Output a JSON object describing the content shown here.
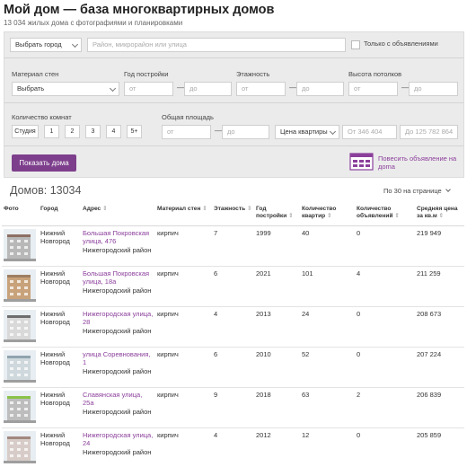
{
  "header": {
    "title": "Мой дом — база многоквартирных домов",
    "subtitle": "13 034 жилых дома с фотографиями и планировками"
  },
  "filters": {
    "city_select": "Выбрать город",
    "search_placeholder": "Район, микрорайон или улица",
    "only_with_ads_label": "Только с объявлениями",
    "wall_material_label": "Материал стен",
    "wall_material_select": "Выбрать",
    "build_year_label": "Год постройки",
    "floors_label": "Этажность",
    "ceiling_label": "Высота потолков",
    "from_placeholder": "от",
    "to_placeholder": "до",
    "rooms_label": "Количество комнат",
    "rooms": [
      "Студия",
      "1",
      "2",
      "3",
      "4",
      "5+"
    ],
    "area_label": "Общая площадь",
    "price_select": "Цена квартиры",
    "price_from_placeholder": "От 346 404",
    "price_to_placeholder": "До 125 782 864",
    "show_button": "Показать дома",
    "post_ad_link": "Повесить объявление на доma"
  },
  "results": {
    "count_label": "Домов: 13034",
    "per_page": "По 30 на странице"
  },
  "table": {
    "headers": {
      "photo": "Фото",
      "city": "Город",
      "address": "Адрес",
      "material": "Материал стен",
      "floors": "Этажность",
      "year": "Год постройки",
      "apartments": "Количество квартир",
      "ads": "Количество объявлений",
      "price": "Средняя цена за кв.м"
    },
    "rows": [
      {
        "city": "Нижний Новгород",
        "address": "Большая Покровская улица, 476",
        "district": "Нижегородский район",
        "material": "кирпич",
        "floors": "7",
        "year": "1999",
        "apartments": "40",
        "ads": "0",
        "price": "219 949"
      },
      {
        "city": "Нижний Новгород",
        "address": "Большая Покровская улица, 18а",
        "district": "Нижегородский район",
        "material": "кирпич",
        "floors": "6",
        "year": "2021",
        "apartments": "101",
        "ads": "4",
        "price": "211 259"
      },
      {
        "city": "Нижний Новгород",
        "address": "Нижегородская улица, 28",
        "district": "Нижегородский район",
        "material": "кирпич",
        "floors": "4",
        "year": "2013",
        "apartments": "24",
        "ads": "0",
        "price": "208 673"
      },
      {
        "city": "Нижний Новгород",
        "address": "улица Соревнования, 1",
        "district": "Нижегородский район",
        "material": "кирпич",
        "floors": "6",
        "year": "2010",
        "apartments": "52",
        "ads": "0",
        "price": "207 224"
      },
      {
        "city": "Нижний Новгород",
        "address": "Славянская улица, 25а",
        "district": "Нижегородский район",
        "material": "кирпич",
        "floors": "9",
        "year": "2018",
        "apartments": "63",
        "ads": "2",
        "price": "206 839"
      },
      {
        "city": "Нижний Новгород",
        "address": "Нижегородская улица, 24",
        "district": "Нижегородский район",
        "material": "кирпич",
        "floors": "4",
        "year": "2012",
        "apartments": "12",
        "ads": "0",
        "price": "205 859"
      }
    ]
  },
  "colors": {
    "accent": "#7d3f8c",
    "link": "#8b3f9b",
    "filter_bg": "#ebebeb"
  }
}
